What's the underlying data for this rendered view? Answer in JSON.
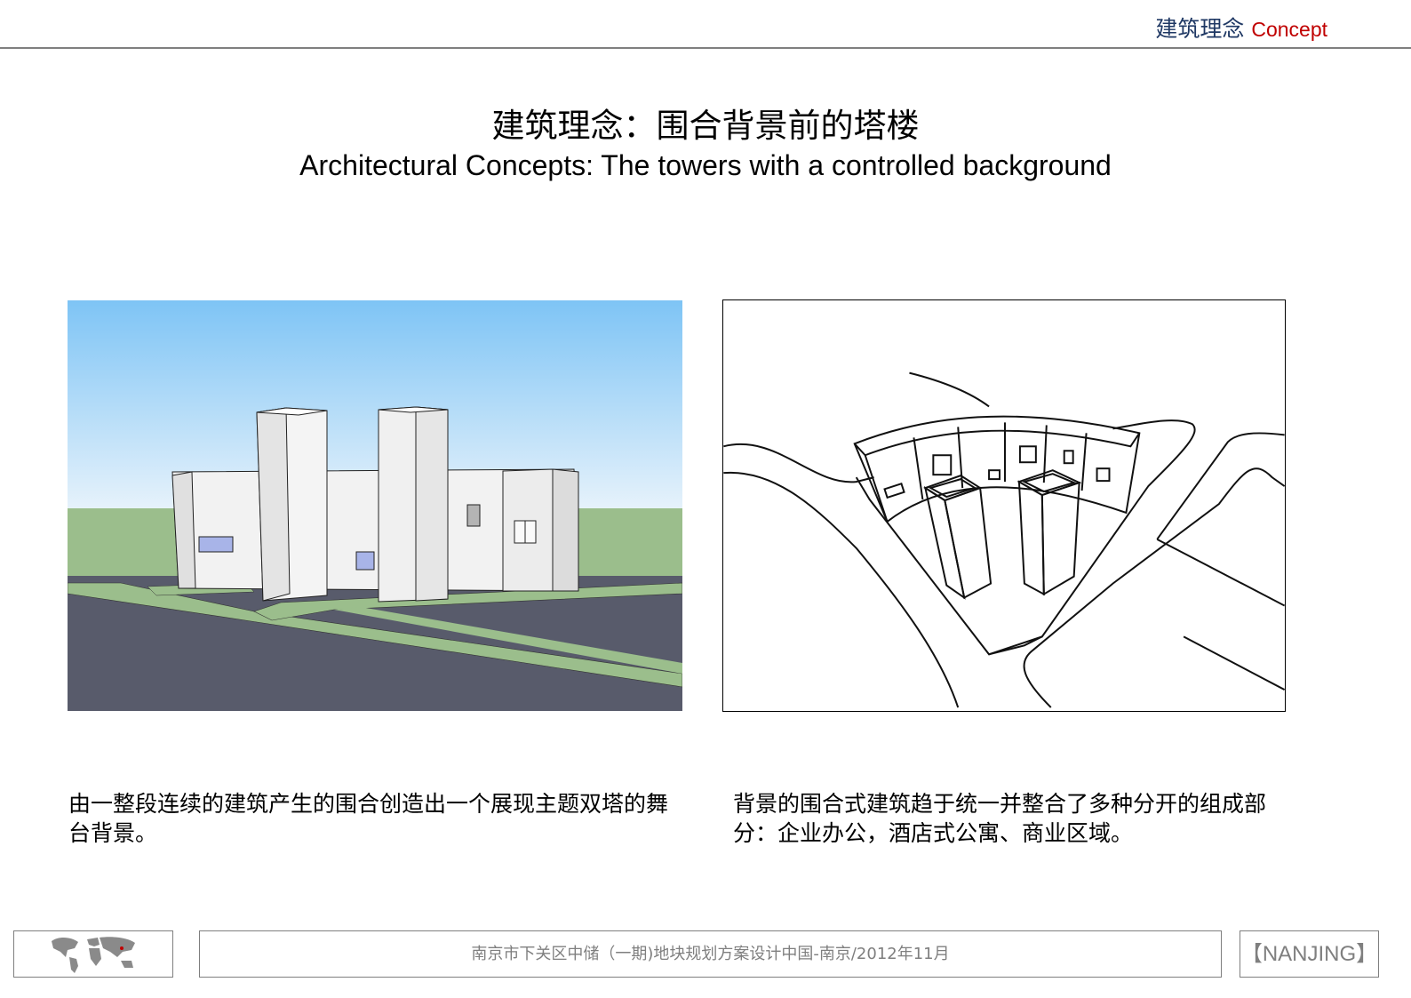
{
  "header": {
    "title_cn": "建筑理念",
    "title_en": "Concept",
    "title_en_color": "#c00000",
    "title_cn_color": "#1f3864"
  },
  "main": {
    "title": "建筑理念：围合背景前的塔楼",
    "subtitle": "Architectural  Concepts: The towers with a controlled background"
  },
  "left_caption": "由一整段连续的建筑产生的围合创造出一个展现主题双塔的舞台背景。",
  "right_caption": "背景的围合式建筑趋于统一并整合了多种分开的组成部分：企业办公，酒店式公寓、商业区域。",
  "footer": {
    "center_text": "南京市下关区中储（一期)地块规划方案设计中国-南京/2012年11月",
    "right_text": "【NANJING】"
  },
  "colors": {
    "sky_top": "#7ec4f5",
    "ground": "#9bbe8c",
    "road": "#585b6b"
  }
}
